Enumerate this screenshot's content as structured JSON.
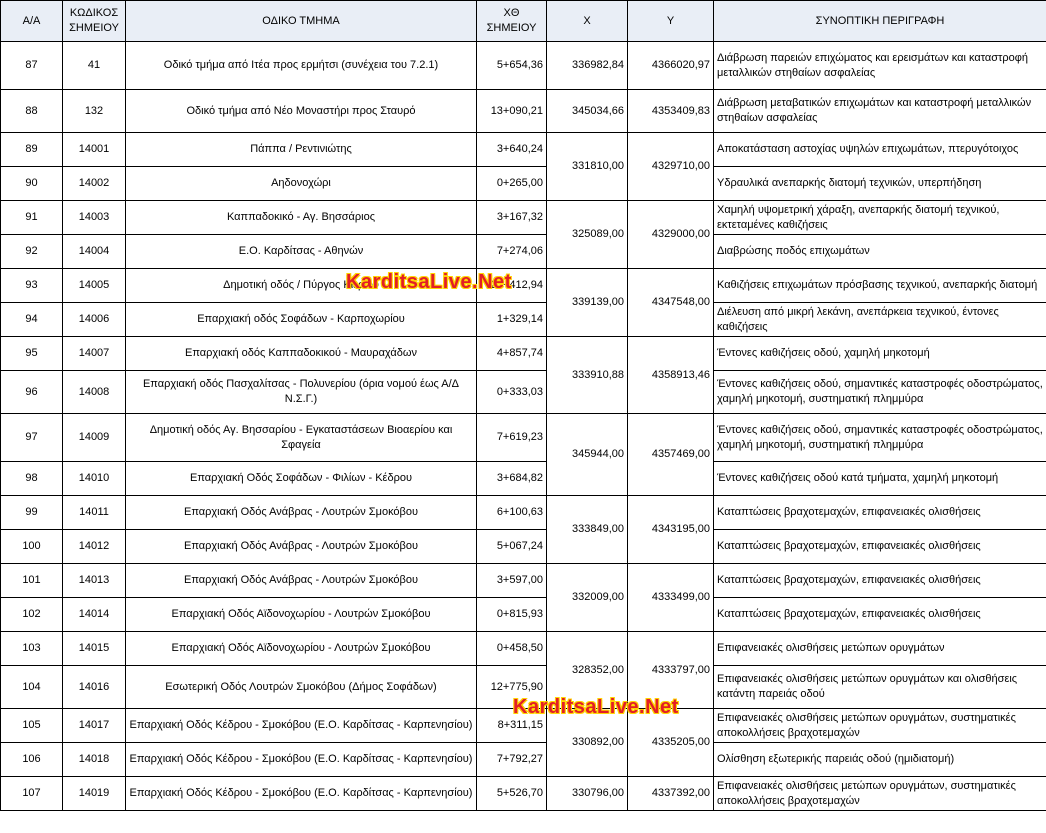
{
  "headers": [
    "Α/Α",
    "ΚΩΔΙΚΟΣ ΣΗΜΕΙΟΥ",
    "ΟΔΙΚΟ ΤΜΗΜΑ",
    "ΧΘ ΣΗΜΕΙΟΥ",
    "Χ",
    "Υ",
    "ΣΥΝΟΠΤΙΚΗ ΠΕΡΙΓΡΑΦΗ"
  ],
  "watermark": "KarditsaLive.Net",
  "rows": [
    {
      "aa": "87",
      "code": "41",
      "section": "Οδικό τμήμα από Ιτέα προς ερμήτσι (συνέχεια του 7.2.1)",
      "ch": "5+654,36",
      "x": "336982,84",
      "y": "4366020,97",
      "desc": "Διάβρωση παρειών επιχώματος και ερεισμάτων και καταστροφή μεταλλικών στηθαίων ασφαλείας"
    },
    {
      "aa": "88",
      "code": "132",
      "section": "Οδικό τμήμα από Νέο Μοναστήρι προς Σταυρό",
      "ch": "13+090,21",
      "x": "345034,66",
      "y": "4353409,83",
      "desc": "Διάβρωση μεταβατικών επιχωμάτων και καταστροφή μεταλλικών στηθαίων ασφαλείας"
    },
    {
      "aa": "89",
      "code": "14001",
      "section": "Πάππα / Ρεντινιώτης",
      "ch": "3+640,24",
      "x": "331810,00",
      "y": "4329710,00",
      "desc": "Αποκατάσταση αστοχίας υψηλών επιχωμάτων, πτερυγότοιχος"
    },
    {
      "aa": "90",
      "code": "14002",
      "section": "Αηδονοχώρι",
      "ch": "0+265,00",
      "desc": "Υδραυλικά ανεπαρκής διατομή τεχνικών, υπερπήδηση"
    },
    {
      "aa": "91",
      "code": "14003",
      "section": "Καππαδοκικό - Αγ. Βησσάριος",
      "ch": "3+167,32",
      "x": "325089,00",
      "y": "4329000,00",
      "desc": "Χαμηλή υψομετρική χάραξη, ανεπαρκής διατομή τεχνικού, εκτεταμένες καθιζήσεις"
    },
    {
      "aa": "92",
      "code": "14004",
      "section": "Ε.Ο. Καρδίτσας - Αθηνών",
      "ch": "7+274,06",
      "desc": "Διαβρώσης ποδός επιχωμάτων"
    },
    {
      "aa": "93",
      "code": "14005",
      "section": "Δημοτική οδός / Πύργος Κιερίου",
      "ch": "20+412,94",
      "x": "339139,00",
      "y": "4347548,00",
      "desc": "Καθιζήσεις επιχωμάτων πρόσβασης τεχνικού, ανεπαρκής διατομή"
    },
    {
      "aa": "94",
      "code": "14006",
      "section": "Επαρχιακή οδός Σοφάδων - Καρποχωρίου",
      "ch": "1+329,14",
      "desc": "Διέλευση από μικρή λεκάνη, ανεπάρκεια τεχνικού, έντονες καθιζήσεις"
    },
    {
      "aa": "95",
      "code": "14007",
      "section": "Επαρχιακή οδός Καππαδοκικού - Μαυραχάδων",
      "ch": "4+857,74",
      "x": "333910,88",
      "y": "4358913,46",
      "desc": "Έντονες καθιζήσεις οδού, χαμηλή μηκοτομή"
    },
    {
      "aa": "96",
      "code": "14008",
      "section": "Επαρχιακή οδός Πασχαλίτσας - Πολυνερίου (όρια νομού έως Α/Δ Ν.Σ.Γ.)",
      "ch": "0+333,03",
      "desc": "Έντονες καθιζήσεις οδού, σημαντικές καταστροφές οδοστρώματος, χαμηλή μηκοτομή, συστηματική πλημμύρα"
    },
    {
      "aa": "97",
      "code": "14009",
      "section": "Δημοτική οδός Αγ. Βησσαρίου - Εγκαταστάσεων Βιοαερίου και Σφαγεία",
      "ch": "7+619,23",
      "x": "345944,00",
      "y": "4357469,00",
      "desc": "Έντονες καθιζήσεις οδού, σημαντικές καταστροφές οδοστρώματος, χαμηλή μηκοτομή, συστηματική πλημμύρα"
    },
    {
      "aa": "98",
      "code": "14010",
      "section": "Επαρχιακή Οδός Σοφάδων - Φιλίων - Κέδρου",
      "ch": "3+684,82",
      "desc": "Έντονες καθιζήσεις οδού κατά τμήματα, χαμηλή μηκοτομή"
    },
    {
      "aa": "99",
      "code": "14011",
      "section": "Επαρχιακή Οδός Ανάβρας - Λουτρών Σμοκόβου",
      "ch": "6+100,63",
      "x": "333849,00",
      "y": "4343195,00",
      "desc": "Καταπτώσεις βραχοτεμαχών, επιφανειακές ολισθήσεις"
    },
    {
      "aa": "100",
      "code": "14012",
      "section": "Επαρχιακή Οδός Ανάβρας - Λουτρών Σμοκόβου",
      "ch": "5+067,24",
      "desc": "Καταπτώσεις βραχοτεμαχών, επιφανειακές ολισθήσεις"
    },
    {
      "aa": "101",
      "code": "14013",
      "section": "Επαρχιακή Οδός Ανάβρας - Λουτρών Σμοκόβου",
      "ch": "3+597,00",
      "x": "332009,00",
      "y": "4333499,00",
      "desc": "Καταπτώσεις βραχοτεμαχών, επιφανειακές ολισθήσεις"
    },
    {
      "aa": "102",
      "code": "14014",
      "section": "Επαρχιακή Οδός Αϊδονοχωρίου - Λουτρών Σμοκόβου",
      "ch": "0+815,93",
      "desc": "Καταπτώσεις βραχοτεμαχών, επιφανειακές ολισθήσεις"
    },
    {
      "aa": "103",
      "code": "14015",
      "section": "Επαρχιακή Οδός Αϊδονοχωρίου - Λουτρών Σμοκόβου",
      "ch": "0+458,50",
      "x": "328352,00",
      "y": "4333797,00",
      "desc": "Επιφανειακές ολισθήσεις μετώπων ορυγμάτων"
    },
    {
      "aa": "104",
      "code": "14016",
      "section": "Εσωτερική Οδός Λουτρών Σμοκόβου (Δήμος Σοφάδων)",
      "ch": "12+775,90",
      "desc": "Επιφανειακές ολισθήσεις μετώπων ορυγμάτων και ολισθήσεις κατάντη παρειάς οδού"
    },
    {
      "aa": "105",
      "code": "14017",
      "section": "Επαρχιακή Οδός Κέδρου - Σμοκόβου (Ε.Ο. Καρδίτσας - Καρπενησίου)",
      "ch": "8+311,15",
      "x": "330892,00",
      "y": "4335205,00",
      "desc": "Επιφανειακές ολισθήσεις μετώπων ορυγμάτων, συστηματικές αποκολλήσεις βραχοτεμαχών"
    },
    {
      "aa": "106",
      "code": "14018",
      "section": "Επαρχιακή Οδός Κέδρου - Σμοκόβου (Ε.Ο. Καρδίτσας - Καρπενησίου)",
      "ch": "7+792,27",
      "desc": "Ολίσθηση εξωτερικής παρειάς οδού (ημιδιατομή)"
    },
    {
      "aa": "107",
      "code": "14019",
      "section": "Επαρχιακή Οδός Κέδρου - Σμοκόβου (Ε.Ο. Καρδίτσας - Καρπενησίου)",
      "ch": "5+526,70",
      "x": "330796,00",
      "y": "4337392,00",
      "desc": "Επιφανειακές ολισθήσεις μετώπων ορυγμάτων, συστηματικές αποκολλήσεις βραχοτεμαχών"
    }
  ]
}
